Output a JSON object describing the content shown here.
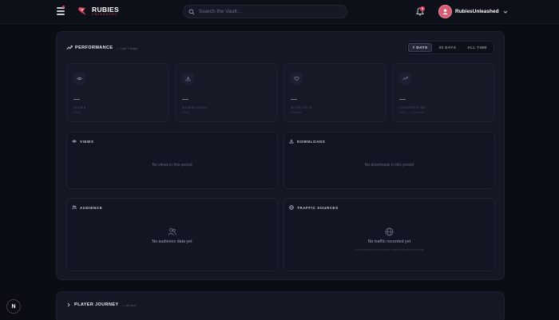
{
  "brand": {
    "name": "RUBIES",
    "subtitle": "UNLEASHED",
    "accent": "#e0405c"
  },
  "search": {
    "placeholder": "Search the Vault..."
  },
  "notifications": {
    "count": "8"
  },
  "user": {
    "name": "RubiesUnleashed"
  },
  "performance": {
    "title": "PERFORMANCE",
    "subtitle": "— Last 7 Days",
    "ranges": [
      {
        "label": "7 DAYS",
        "active": true
      },
      {
        "label": "30 DAYS",
        "active": false
      },
      {
        "label": "ALL TIME",
        "active": false
      }
    ],
    "stats": [
      {
        "icon": "eye-icon",
        "value": "—",
        "label": "VIEWS",
        "sub": "0 total"
      },
      {
        "icon": "download-icon",
        "value": "—",
        "label": "DOWNLOADS",
        "sub": "0 total"
      },
      {
        "icon": "heart-icon",
        "value": "—",
        "label": "WISHLISTS",
        "sub": "0 all-time"
      },
      {
        "icon": "trend-icon",
        "value": "—",
        "label": "CONVERSION",
        "sub": "views → downloads"
      }
    ],
    "views_chart": {
      "title": "VIEWS",
      "empty": "No views in this period"
    },
    "downloads_chart": {
      "title": "DOWNLOADS",
      "empty": "No downloads in this period"
    },
    "audience": {
      "title": "AUDIENCE",
      "empty": "No audience data yet"
    },
    "traffic": {
      "title": "TRAFFIC SOURCES",
      "empty": "No traffic recorded yet",
      "hint": "Sources appear once players start visiting your projects"
    }
  },
  "journey": {
    "title": "PLAYER JOURNEY",
    "subtitle": "— all time"
  },
  "corner": {
    "label": "N"
  }
}
